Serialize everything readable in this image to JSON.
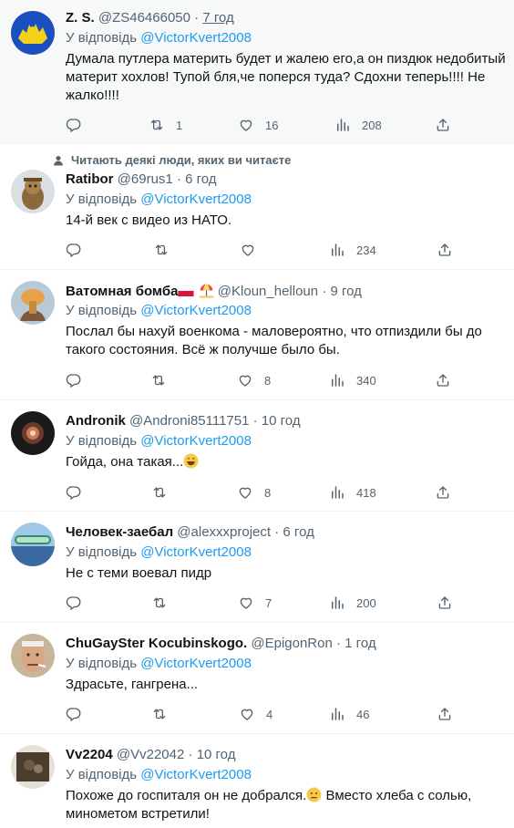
{
  "reply_prefix": "У відповідь",
  "context_label": "Читають деякі люди, яких ви читаєте",
  "tweets": [
    {
      "name": "Z. S.",
      "handle": "@ZS46466050",
      "time": "7 год",
      "mention": "@VictorKvert2008",
      "text": "Думала путлера материть будет и жалею его,а он пиздюк недобитый материт хохлов! Тупой бля,че поперся туда? Сдохни теперь!!!! Не жалко!!!!",
      "retweets": "1",
      "likes": "16",
      "views": "208"
    },
    {
      "name": "Ratibor",
      "handle": "@69rus1",
      "time": "6 год",
      "mention": "@VictorKvert2008",
      "text": "14-й век с видео из НАТО.",
      "retweets": "",
      "likes": "",
      "views": "234"
    },
    {
      "name": "Ватомная бомба",
      "handle": "@Kloun_helloun",
      "time": "9 год",
      "mention": "@VictorKvert2008",
      "text": "Послал бы нахуй военкома - маловероятно, что отпиздили бы до такого состояния. Всё ж получше было бы.",
      "retweets": "",
      "likes": "8",
      "views": "340"
    },
    {
      "name": "Andronik",
      "handle": "@Androni85111751",
      "time": "10 год",
      "mention": "@VictorKvert2008",
      "text": "Гойда, она такая...",
      "retweets": "",
      "likes": "8",
      "views": "418"
    },
    {
      "name": "Человек-заебал",
      "handle": "@alexxxproject",
      "time": "6 год",
      "mention": "@VictorKvert2008",
      "text": "Не с теми воевал пидр",
      "retweets": "",
      "likes": "7",
      "views": "200"
    },
    {
      "name": "ChuGaySter Kocubinskogo.",
      "handle": "@EpigonRon",
      "time": "1 год",
      "mention": "@VictorKvert2008",
      "text": "Здрасьте, гангрена...",
      "retweets": "",
      "likes": "4",
      "views": "46"
    },
    {
      "name": "Vv2204",
      "handle": "@Vv22042",
      "time": "10 год",
      "mention": "@VictorKvert2008",
      "text1": "Похоже до госпиталя он не добрался.",
      "text2": " Вместо хлеба с солью, минометом встретили!"
    }
  ],
  "icons": [
    "reply-icon",
    "retweet-icon",
    "like-icon",
    "views-icon",
    "share-icon"
  ],
  "colors": {
    "link": "#1d9bf0",
    "secondary": "#536471",
    "text": "#0f1419",
    "highlight_bg": "#f7f9f9"
  }
}
